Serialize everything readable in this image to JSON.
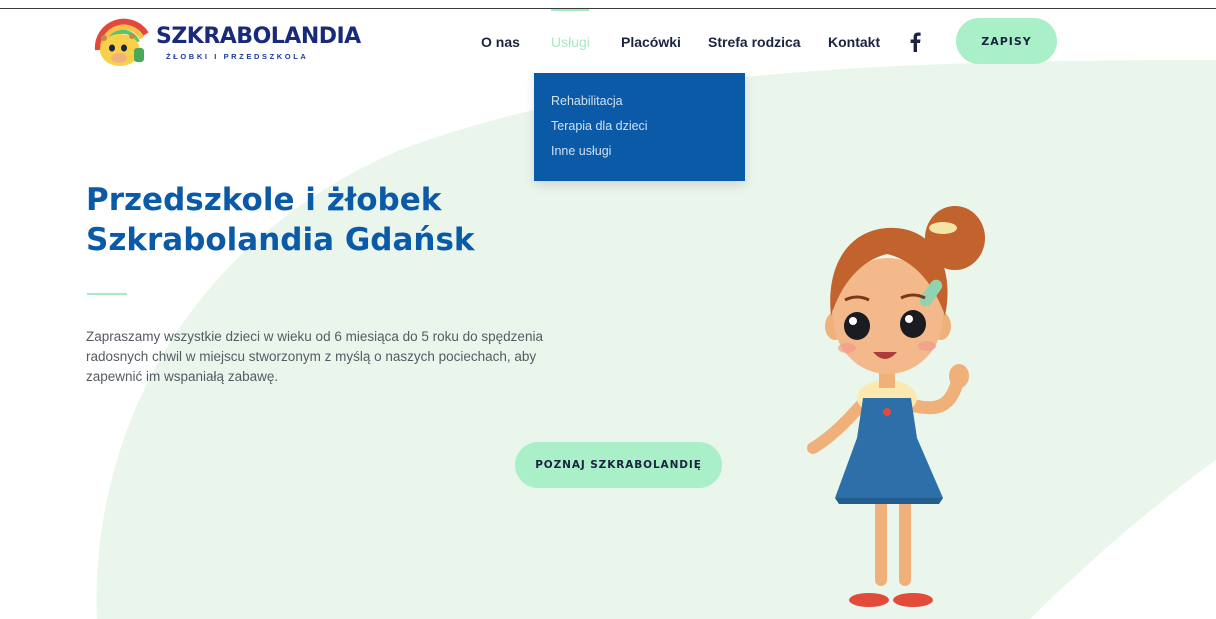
{
  "brand": {
    "name": "SZKRABOLANDIA",
    "tagline": "ŻŁOBKI I PRZEDSZKOLA",
    "logo_icon": "giraffe-logo-icon"
  },
  "nav": {
    "items": [
      {
        "label": "O nas"
      },
      {
        "label": "Usługi",
        "active": true
      },
      {
        "label": "Placówki"
      },
      {
        "label": "Strefa rodzica"
      },
      {
        "label": "Kontakt"
      }
    ],
    "facebook_icon": "facebook-icon",
    "cta_label": "ZAPISY"
  },
  "dropdown": {
    "items": [
      "Rehabilitacja",
      "Terapia dla dzieci",
      "Inne usługi"
    ]
  },
  "hero": {
    "title_line1": "Przedszkole i żłobek",
    "title_line2": "Szkrabolandia Gdańsk",
    "description": "Zapraszamy wszystkie dzieci w wieku od 6 miesiąca do 5 roku do spędzenia radosnych chwil w miejscu stworzonym z myślą o naszych pociechach, aby zapewnić im wspaniałą zabawę.",
    "cta_label": "POZNAJ SZKRABOLANDIĘ",
    "illustration": "girl-illustration"
  },
  "colors": {
    "primary": "#0a5aa8",
    "accent": "#a9efc8",
    "nav_text": "#1b2340",
    "hero_shape": "#eaf5ec"
  }
}
